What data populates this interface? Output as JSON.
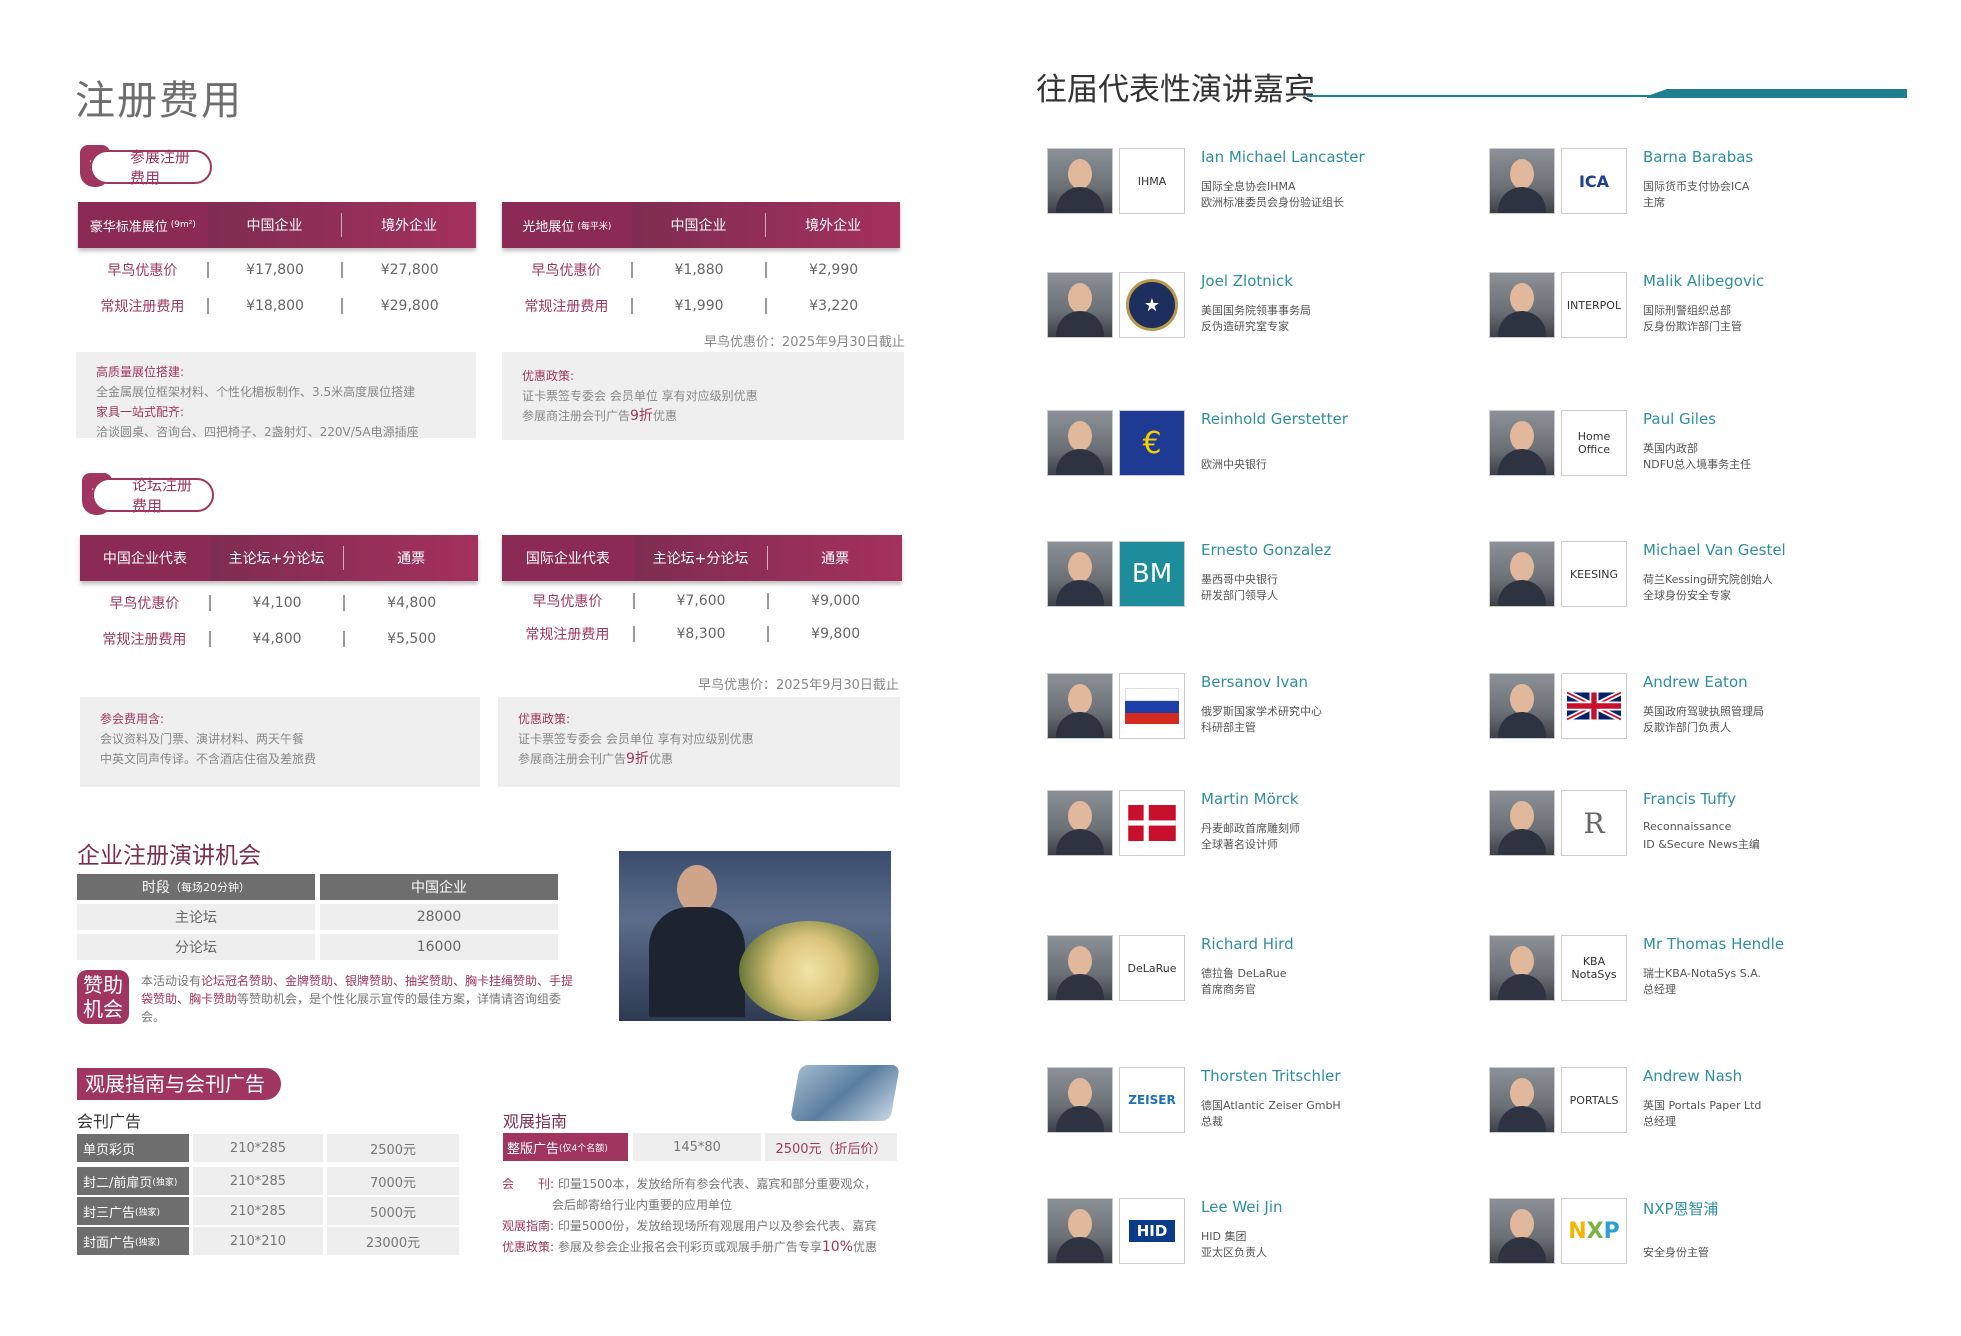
{
  "left": {
    "page_title": "注册费用",
    "exhibit_pill": "参展注册费用",
    "forum_pill": "论坛注册费用",
    "booth_table_a": {
      "headers": [
        "豪华标准展位",
        "(9m²)",
        "中国企业",
        "境外企业"
      ],
      "rows": [
        {
          "label": "早鸟优惠价",
          "v1": "¥17,800",
          "v2": "¥27,800"
        },
        {
          "label": "常规注册费用",
          "v1": "¥18,800",
          "v2": "¥29,800"
        }
      ]
    },
    "booth_table_b": {
      "headers": [
        "光地展位",
        "(每平米)",
        "中国企业",
        "境外企业"
      ],
      "rows": [
        {
          "label": "早鸟优惠价",
          "v1": "¥1,880",
          "v2": "¥2,990"
        },
        {
          "label": "常规注册费用",
          "v1": "¥1,990",
          "v2": "¥3,220"
        }
      ]
    },
    "booth_deadline": "早鸟优惠价：2025年9月30日截止",
    "booth_box_a": {
      "h1": "高质量展位搭建:",
      "t1": "全金属展位框架材料、个性化楣板制作、3.5米高度展位搭建",
      "h2": "家具一站式配齐:",
      "t2": "洽谈圆桌、咨询台、四把椅子、2盏射灯、220V/5A电源插座"
    },
    "booth_box_b": {
      "h1": "优惠政策:",
      "t1": "证卡票签专委会 会员单位 享有对应级别优惠",
      "t2a": "参展商注册会刊广告",
      "t2b": "9折",
      "t2c": "优惠"
    },
    "forum_table_a": {
      "headers": [
        "中国企业代表",
        "主论坛+分论坛",
        "通票"
      ],
      "rows": [
        {
          "label": "早鸟优惠价",
          "v1": "¥4,100",
          "v2": "¥4,800"
        },
        {
          "label": "常规注册费用",
          "v1": "¥4,800",
          "v2": "¥5,500"
        }
      ]
    },
    "forum_table_b": {
      "headers": [
        "国际企业代表",
        "主论坛+分论坛",
        "通票"
      ],
      "rows": [
        {
          "label": "早鸟优惠价",
          "v1": "¥7,600",
          "v2": "¥9,000"
        },
        {
          "label": "常规注册费用",
          "v1": "¥8,300",
          "v2": "¥9,800"
        }
      ]
    },
    "forum_deadline": "早鸟优惠价：2025年9月30日截止",
    "forum_box_a": {
      "h1": "参会费用含:",
      "t1": "会议资料及门票、演讲材料、两天午餐",
      "t2": "中英文同声传译。不含酒店住宿及差旅费"
    },
    "forum_box_b": {
      "h1": "优惠政策:",
      "t1": "证卡票签专委会 会员单位 享有对应级别优惠",
      "t2a": "参展商注册会刊广告",
      "t2b": "9折",
      "t2c": "优惠"
    },
    "speech": {
      "title": "企业注册演讲机会",
      "header_slot": "时段",
      "header_slot_note": "（每场20分钟）",
      "header_cn": "中国企业",
      "rows": [
        {
          "slot": "主论坛",
          "price": "28000"
        },
        {
          "slot": "分论坛",
          "price": "16000"
        }
      ]
    },
    "sponsor": {
      "badge_line1": "赞助",
      "badge_line2": "机会",
      "p1": "本活动设有",
      "p2": "论坛冠名赞助、金牌赞助、银牌赞助、抽奖赞助、胸卡挂绳赞助、",
      "p3": "手提袋赞助、胸卡赞助",
      "p4": "等赞助机会，是个性化展示宣传的最佳方案，详情请",
      "p5": "咨询组委会。"
    },
    "guide": {
      "title": "观展指南与会刊广告",
      "catalog_label": "会刊广告",
      "guide_label": "观展指南",
      "ads": [
        {
          "name": "单页彩页",
          "note": "",
          "size": "210*285",
          "price": "2500元"
        },
        {
          "name": "封二/前扉页",
          "note": "(独家)",
          "size": "210*285",
          "price": "7000元"
        },
        {
          "name": "封三广告",
          "note": "(独家)",
          "size": "210*285",
          "price": "5000元"
        },
        {
          "name": "封面广告",
          "note": "(独家)",
          "size": "210*210",
          "price": "23000元"
        }
      ],
      "guide_ad": {
        "name": "整版广告",
        "note": "(仅4个名额)",
        "size": "145*80",
        "price": "2500元（折后价）"
      },
      "desc": [
        {
          "key": "会　　刊:",
          "text": "印量1500本，发放给所有参会代表、嘉宾和部分重要观众，"
        },
        {
          "key": "",
          "text": "会后邮寄给行业内重要的应用单位"
        },
        {
          "key": "观展指南:",
          "text": "印量5000份，发放给现场所有观展用户以及参会代表、嘉宾"
        },
        {
          "key": "优惠政策:",
          "text": "参展及参会企业报名会刊彩页或观展手册广告专享",
          "pct": "10%",
          "tail": "优惠"
        }
      ]
    }
  },
  "right": {
    "title": "往届代表性演讲嘉宾",
    "speakers": [
      {
        "name": "Ian Michael Lancaster",
        "line1": "国际全息协会IHMA",
        "line2": "欧洲标准委员会身份验证组长",
        "logo": "IHMA"
      },
      {
        "name": "Barna Barabas",
        "line1": "国际货币支付协会ICA",
        "line2": "主席",
        "logo": "ICA"
      },
      {
        "name": "Joel Zlotnick",
        "line1": "美国国务院领事事务局",
        "line2": "反伪造研究室专家",
        "logo": "seal-icon"
      },
      {
        "name": "Malik Alibegovic",
        "line1": "国际刑警组织总部",
        "line2": "反身份欺诈部门主管",
        "logo": "INTERPOL"
      },
      {
        "name": "Reinhold Gerstetter",
        "line1": "",
        "line2": "欧洲中央银行",
        "logo": "euro-icon"
      },
      {
        "name": "Paul Giles",
        "line1": "英国内政部",
        "line2": "NDFU总入境事务主任",
        "logo": "Home Office"
      },
      {
        "name": "Ernesto Gonzalez",
        "line1": "墨西哥中央银行",
        "line2": "研发部门领导人",
        "logo": "BM"
      },
      {
        "name": "Michael Van Gestel",
        "line1": "荷兰Kessing研究院创始人",
        "line2": "全球身份安全专家",
        "logo": "KEESING"
      },
      {
        "name": "Bersanov Ivan",
        "line1": "俄罗斯国家学术研究中心",
        "line2": "科研部主管",
        "logo": "russia-flag"
      },
      {
        "name": "Andrew Eaton",
        "line1": "英国政府驾驶执照管理局",
        "line2": "反欺诈部门负责人",
        "logo": "uk-flag"
      },
      {
        "name": "Martin Mörck",
        "line1": "丹麦邮政首席雕刻师",
        "line2": "全球著名设计师",
        "logo": "denmark-flag"
      },
      {
        "name": "Francis Tuffy",
        "line1": "Reconnaissance",
        "line2": "ID &Secure News主编",
        "logo": "R"
      },
      {
        "name": "Richard Hird",
        "line1": "德拉鲁 DeLaRue",
        "line2": "首席商务官",
        "logo": "DeLaRue"
      },
      {
        "name": "Mr Thomas Hendle",
        "line1": "瑞士KBA-NotaSys S.A.",
        "line2": "总经理",
        "logo": "KBA NotaSys"
      },
      {
        "name": "Thorsten Tritschler",
        "line1": "德国Atlantic Zeiser GmbH",
        "line2": "总裁",
        "logo": "ZEISER"
      },
      {
        "name": "Andrew Nash",
        "line1": "英国 Portals Paper Ltd",
        "line2": "总经理",
        "logo": "PORTALS"
      },
      {
        "name": "Lee Wei Jin",
        "line1": "HID 集团",
        "line2": "亚太区负责人",
        "logo": "HID"
      },
      {
        "name": "NXP恩智浦",
        "line1": "",
        "line2": "安全身份主管",
        "logo": "NXP"
      }
    ]
  },
  "colors": {
    "accent": "#a0365f",
    "teal": "#2f8fa0",
    "grey": "#6e6e6e"
  }
}
